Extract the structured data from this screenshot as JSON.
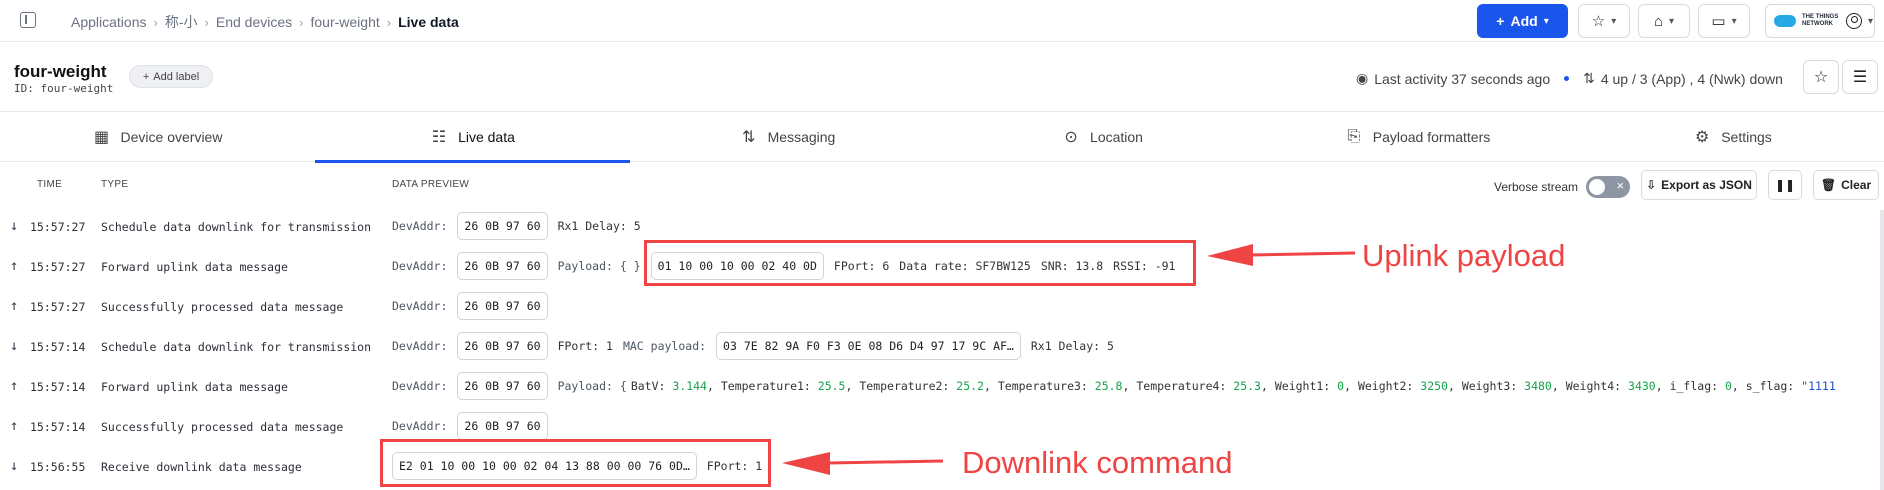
{
  "breadcrumb": [
    "Applications",
    "称-小",
    "End devices",
    "four-weight",
    "Live data"
  ],
  "topbar": {
    "add_label": "Add",
    "ttn_brand": "THE THINGS NETWORK"
  },
  "device": {
    "name": "four-weight",
    "id_label": "ID: four-weight",
    "add_label_btn": "Add label"
  },
  "activity": {
    "last": "Last activity 37 seconds ago",
    "counts": "4 up / 3 (App) , 4 (Nwk) down"
  },
  "tabs": [
    {
      "label": "Device overview",
      "icon": "grid-icon"
    },
    {
      "label": "Live data",
      "icon": "list-icon"
    },
    {
      "label": "Messaging",
      "icon": "updown-icon"
    },
    {
      "label": "Location",
      "icon": "pin-icon"
    },
    {
      "label": "Payload formatters",
      "icon": "code-icon"
    },
    {
      "label": "Settings",
      "icon": "gear-icon"
    }
  ],
  "table": {
    "col_time": "TIME",
    "col_type": "TYPE",
    "col_preview": "DATA PREVIEW",
    "verbose": "Verbose stream",
    "export": "Export as JSON",
    "clear": "Clear"
  },
  "rows": [
    {
      "dir": "down",
      "time": "15:57:27",
      "type": "Schedule data downlink for transmission",
      "devaddr": "26 0B 97 60",
      "extra": "Rx1 Delay: 5"
    },
    {
      "dir": "up",
      "time": "15:57:27",
      "type": "Forward uplink data message",
      "devaddr": "26 0B 97 60",
      "payload_lbl": "Payload: { }",
      "payload_hex": "01 10 00 10 00 02 40 0D",
      "fport": "FPort: 6",
      "datarate": "Data rate: SF7BW125",
      "snr": "SNR: 13.8",
      "rssi": "RSSI: -91"
    },
    {
      "dir": "up",
      "time": "15:57:27",
      "type": "Successfully processed data message",
      "devaddr": "26 0B 97 60"
    },
    {
      "dir": "down",
      "time": "15:57:14",
      "type": "Schedule data downlink for transmission",
      "devaddr": "26 0B 97 60",
      "fport": "FPort: 1",
      "mac_lbl": "MAC payload:",
      "mac_hex": "03 7E 82 9A F0 F3 0E 08 D6 D4 97 17 9C AF…",
      "extra": "Rx1 Delay: 5"
    },
    {
      "dir": "up",
      "time": "15:57:14",
      "type": "Forward uplink data message",
      "devaddr": "26 0B 97 60",
      "decoded": {
        "prefix": "Payload: {",
        "fields": [
          {
            "k": "BatV: ",
            "v": "3.144"
          },
          {
            "k": "Temperature1: ",
            "v": "25.5"
          },
          {
            "k": "Temperature2: ",
            "v": "25.2"
          },
          {
            "k": "Temperature3: ",
            "v": "25.8"
          },
          {
            "k": "Temperature4: ",
            "v": "25.3"
          },
          {
            "k": "Weight1: ",
            "v": "0"
          },
          {
            "k": "Weight2: ",
            "v": "3250"
          },
          {
            "k": "Weight3: ",
            "v": "3480"
          },
          {
            "k": "Weight4: ",
            "v": "3430"
          },
          {
            "k": "i_flag: ",
            "v": "0"
          }
        ],
        "last_k": "s_flag: ",
        "last_v": "\"1111"
      }
    },
    {
      "dir": "up",
      "time": "15:57:14",
      "type": "Successfully processed data message",
      "devaddr": "26 0B 97 60"
    },
    {
      "dir": "down",
      "time": "15:56:55",
      "type": "Receive downlink data message",
      "payload_hex": "E2 01 10 00 10 00 02 04 13 88 00 00 76 0D…",
      "fport": "FPort: 1"
    }
  ],
  "labels": {
    "devaddr": "DevAddr:"
  },
  "annotations": {
    "uplink": "Uplink payload",
    "downlink": "Downlink command"
  },
  "colors": {
    "accent": "#1a55ec",
    "annotation": "#ef4444",
    "value_green": "#16a34a"
  }
}
